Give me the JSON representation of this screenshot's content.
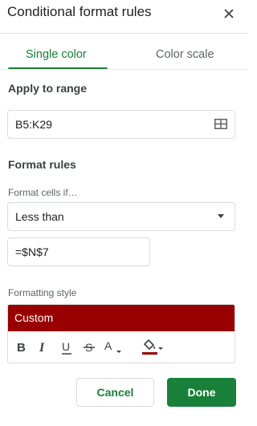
{
  "panel": {
    "title": "Conditional format rules",
    "close_icon": "close-icon"
  },
  "tabs": [
    {
      "label": "Single color",
      "active": true
    },
    {
      "label": "Color scale",
      "active": false
    }
  ],
  "apply_range": {
    "section_label": "Apply to range",
    "value": "B5:K29",
    "icon": "grid-select-icon"
  },
  "format_rules": {
    "section_label": "Format rules",
    "condition_label": "Format cells if…",
    "condition_value": "Less than",
    "value_input": "=$N$7"
  },
  "formatting_style": {
    "label": "Formatting style",
    "preset_label": "Custom",
    "preset_color": "#990000",
    "toolbar": [
      "bold-icon",
      "italic-icon",
      "underline-icon",
      "strikethrough-icon",
      "text-color-icon",
      "fill-color-icon"
    ],
    "fill_color": "#990000"
  },
  "actions": {
    "cancel": "Cancel",
    "done": "Done"
  },
  "accent_color": "#188038"
}
